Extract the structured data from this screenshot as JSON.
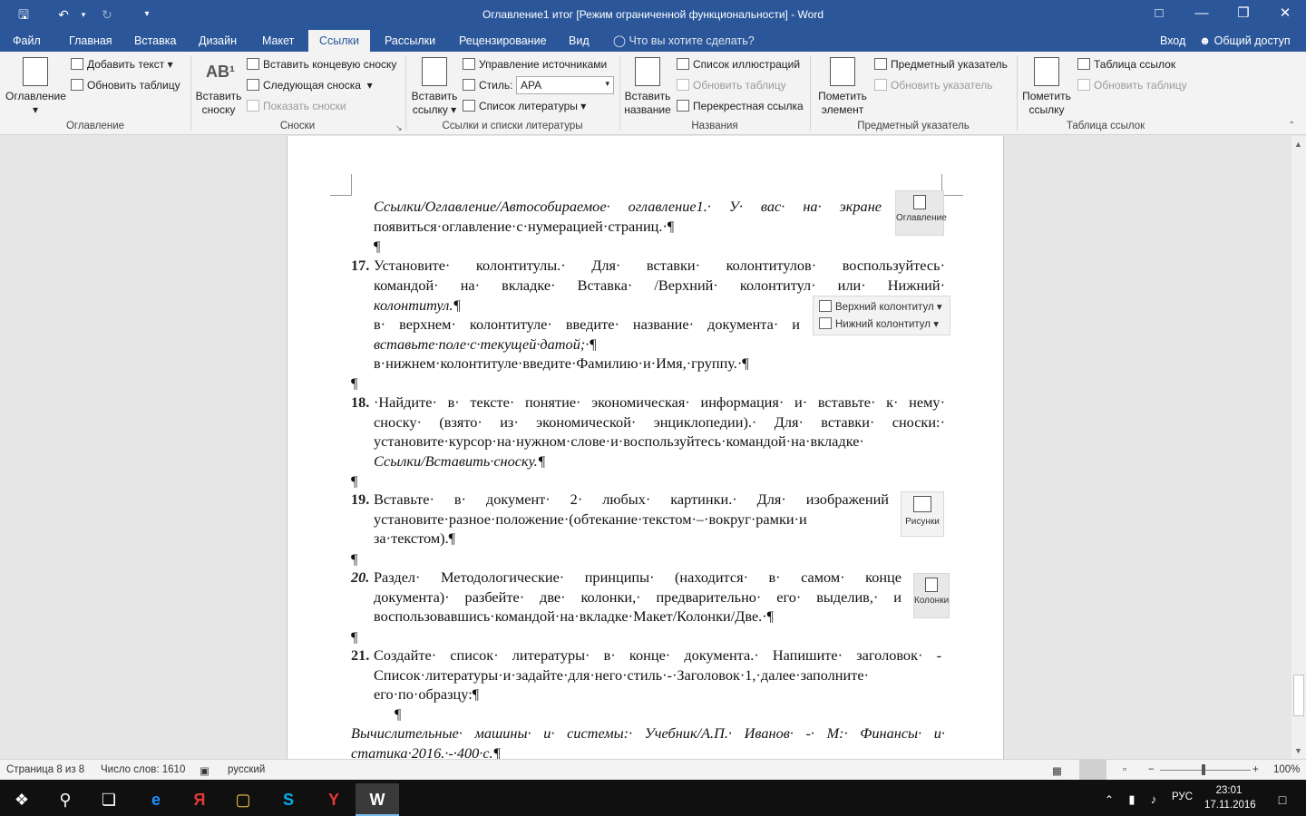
{
  "titlebar": {
    "title": "Оглавление1 итог [Режим ограниченной функциональности] - Word",
    "save_icon": "save-icon",
    "undo_icon": "undo-icon",
    "redo_icon": "redo-icon"
  },
  "tabs": [
    {
      "label": "Файл"
    },
    {
      "label": "Главная"
    },
    {
      "label": "Вставка"
    },
    {
      "label": "Дизайн"
    },
    {
      "label": "Макет"
    },
    {
      "label": "Ссылки",
      "active": true
    },
    {
      "label": "Рассылки"
    },
    {
      "label": "Рецензирование"
    },
    {
      "label": "Вид"
    }
  ],
  "tell_me": "Что вы хотите сделать?",
  "signin": "Вход",
  "share": "Общий доступ",
  "ribbon": {
    "toc": {
      "big": "Оглавление",
      "add_text": "Добавить текст",
      "update": "Обновить таблицу",
      "group": "Оглавление"
    },
    "footnotes": {
      "insert_big_1": "Вставить",
      "insert_big_2": "сноску",
      "insert_endnote": "Вставить концевую сноску",
      "next": "Следующая сноска",
      "show": "Показать сноски",
      "group": "Сноски"
    },
    "citations": {
      "insert_big_1": "Вставить",
      "insert_big_2": "ссылку",
      "manage": "Управление источниками",
      "style_label": "Стиль:",
      "style_value": "APA",
      "bibliography": "Список литературы",
      "group": "Ссылки и списки литературы"
    },
    "captions": {
      "insert_big_1": "Вставить",
      "insert_big_2": "название",
      "figures": "Список иллюстраций",
      "update": "Обновить таблицу",
      "cross": "Перекрестная ссылка",
      "group": "Названия"
    },
    "index": {
      "mark_1": "Пометить",
      "mark_2": "элемент",
      "insert": "Предметный указатель",
      "update": "Обновить указатель",
      "group": "Предметный указатель"
    },
    "authorities": {
      "mark_1": "Пометить",
      "mark_2": "ссылку",
      "insert": "Таблица ссылок",
      "update": "Обновить таблицу",
      "group": "Таблица ссылок"
    }
  },
  "doc": {
    "l1": "Ссылки/Оглавление/Автособираемое· оглавление1.· У· вас· на· экране",
    "l2": "появиться·оглавление·с·нумерацией·страниц.·¶",
    "pilcrow": "¶",
    "n17": "17.",
    "l3": "Установите· колонтитулы.· Для· вставки· колонтитулов· воспользуйтесь·",
    "l4": "командой· на· вкладке· Вставка· /Верхний· колонтитул· или· Нижний·",
    "l5": "колонтитул.¶",
    "l6": "в· верхнем· колонтитуле· введите· название· документа· и",
    "l7": "вставьте·поле·с·текущей·датой;·¶",
    "l8": "в·нижнем·колонтитуле·введите·Фамилию·и·Имя,·группу.·¶",
    "n18": "18.",
    "l9": "·Найдите· в· тексте· понятие· экономическая· информация· и· вставьте· к· нему·",
    "l10": "сноску· (взято· из· экономической· энциклопедии).· Для· вставки· сноски:·",
    "l11": "установите·курсор·на·нужном·слове·и·воспользуйтесь·командой·на·вкладке·",
    "l12": "Ссылки/Вставить·сноску.¶",
    "n19": "19.",
    "l13": "Вставьте· в· документ· 2· любых· картинки.· Для· изображений",
    "l14": "установите·разное·положение·(обтекание·текстом·–·вокруг·рамки·и",
    "l15": "за·текстом).¶",
    "n20": "20.",
    "l16": "Раздел· Методологические· принципы· (находится· в· самом· конце",
    "l17": "документа)· разбейте· две· колонки,· предварительно· его· выделив,· и",
    "l18": "воспользовавшись·командой·на·вкладке·Макет/Колонки/Две.·¶",
    "n21": "21.",
    "l19": "Создайте· список· литературы· в· конце· документа.· Напишите· заголовок· -",
    "l20": "Список·литературы·и·задайте·для·него·стиль·-·Заголовок·1,·далее·заполните·",
    "l21": "его·по·образцу:¶",
    "l22": "Вычислительные· машины· и· системы:· Учебник/А.П.· Иванов· -· М:· Финансы· и·",
    "l23": "статика·2016.·-·400·с.¶",
    "float_toc": "Оглавление",
    "float_header": "Верхний колонтитул",
    "float_footer": "Нижний колонтитул",
    "float_pictures": "Рисунки",
    "float_columns": "Колонки"
  },
  "status": {
    "page": "Страница 8 из 8",
    "words": "Число слов: 1610",
    "lang": "русский",
    "zoom": "100%",
    "zoom_level": 1.0
  },
  "taskbar": {
    "lang": "РУС",
    "time": "23:01",
    "date": "17.11.2016"
  }
}
